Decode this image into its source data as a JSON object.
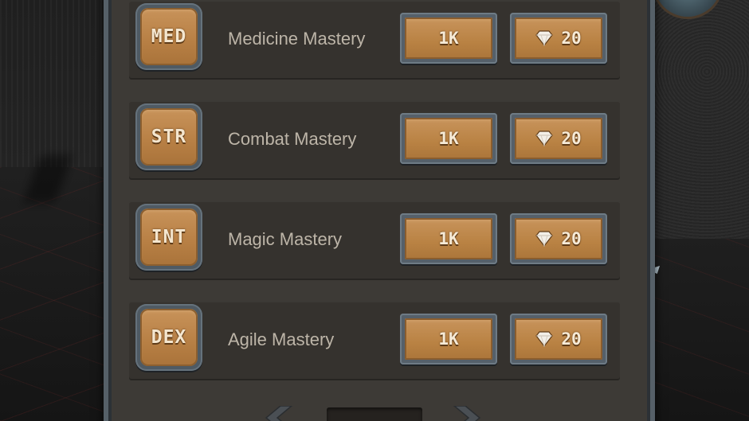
{
  "masteries": [
    {
      "badge": "MED",
      "label": "Medicine Mastery",
      "cost": "1K",
      "gems": "20"
    },
    {
      "badge": "STR",
      "label": "Combat Mastery",
      "cost": "1K",
      "gems": "20"
    },
    {
      "badge": "INT",
      "label": "Magic Mastery",
      "cost": "1K",
      "gems": "20"
    },
    {
      "badge": "DEX",
      "label": "Agile Mastery",
      "cost": "1K",
      "gems": "20"
    }
  ],
  "icons": {
    "gem": "diamond-icon",
    "prev": "chevron-left-icon",
    "next": "chevron-right-icon"
  },
  "colors": {
    "panel": "#3d3a36",
    "button_face": "#b98243",
    "frame": "#566068",
    "label_text": "#bdb5a8"
  }
}
